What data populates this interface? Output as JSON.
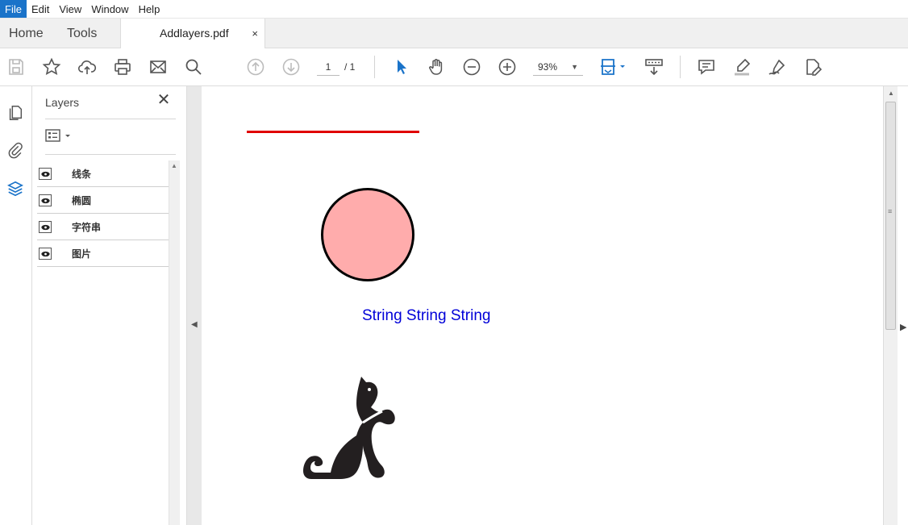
{
  "menu": [
    "File",
    "Edit",
    "View",
    "Window",
    "Help"
  ],
  "tabs": {
    "home": "Home",
    "tools": "Tools",
    "document": "Addlayers.pdf",
    "close": "×"
  },
  "toolbar": {
    "page_current": "1",
    "page_total": "/ 1",
    "zoom": "93%",
    "icons": [
      "save-icon",
      "bookmark-star-icon",
      "cloud-upload-icon",
      "print-icon",
      "email-icon",
      "find-icon",
      "previous-page-icon",
      "next-page-icon",
      "select-cursor-icon",
      "hand-tool-icon",
      "zoom-out-icon",
      "zoom-in-icon",
      "fit-page-icon",
      "scrolling-mode-icon",
      "comment-icon",
      "highlight-icon",
      "sign-icon",
      "edit-pdf-icon"
    ]
  },
  "rail": {
    "icons": [
      "pages-icon",
      "attachments-icon",
      "layers-icon"
    ]
  },
  "layers_panel": {
    "title": "Layers",
    "close": "✕",
    "layers": [
      {
        "name": "线条"
      },
      {
        "name": "椭圆"
      },
      {
        "name": "字符串"
      },
      {
        "name": "图片"
      }
    ]
  },
  "document": {
    "string_text": "String String String",
    "line_color": "#e00000",
    "circle_fill": "#ffacac",
    "text_color": "#0000d8"
  },
  "colors": {
    "accent": "#1a73c9",
    "icon": "#555555"
  }
}
